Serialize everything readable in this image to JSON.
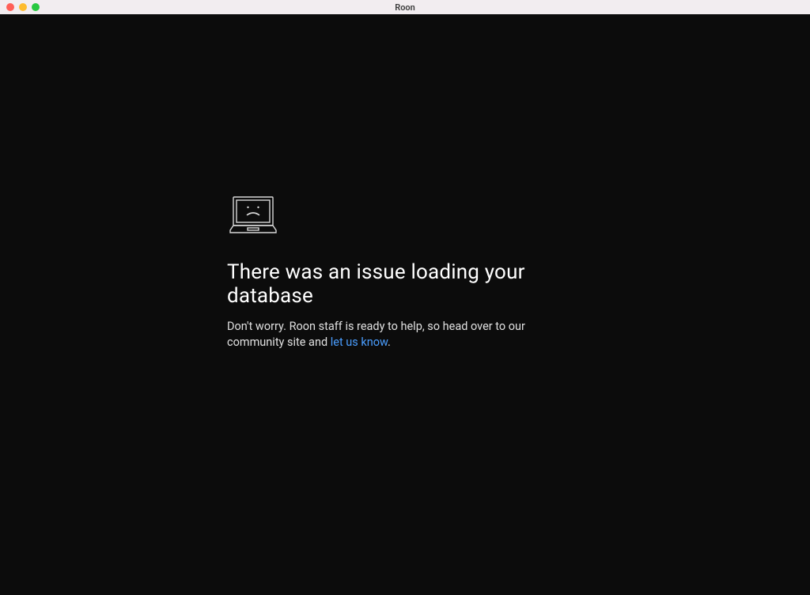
{
  "window": {
    "title": "Roon"
  },
  "error": {
    "heading": "There was an issue loading your database",
    "body_prefix": "Don't worry. Roon staff is ready to help, so head over to our community site and ",
    "link_text": "let us know",
    "body_suffix": "."
  }
}
